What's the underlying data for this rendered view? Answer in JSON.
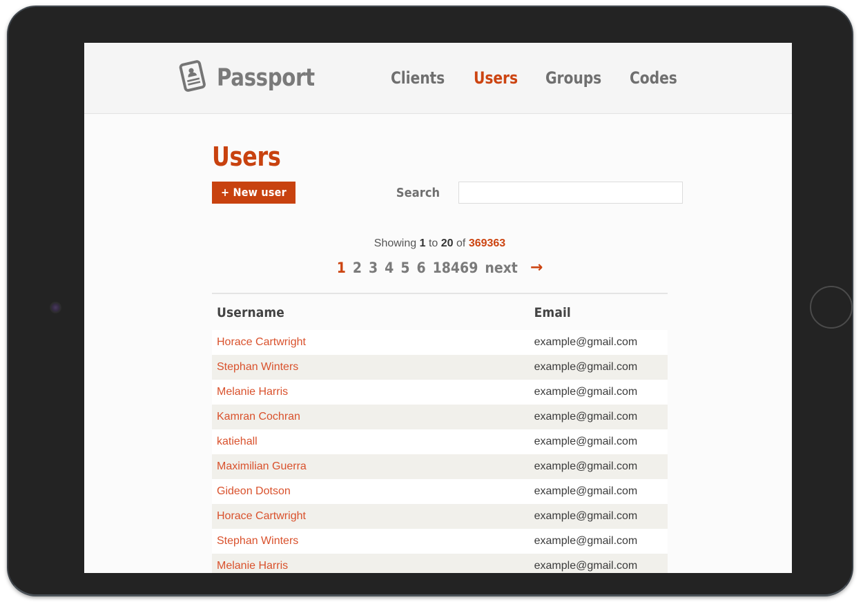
{
  "brand": {
    "name": "Passport",
    "icon": "id-card-icon"
  },
  "nav": {
    "items": [
      {
        "label": "Clients",
        "active": false
      },
      {
        "label": "Users",
        "active": true
      },
      {
        "label": "Groups",
        "active": false
      },
      {
        "label": "Codes",
        "active": false
      }
    ]
  },
  "page": {
    "title": "Users"
  },
  "actions": {
    "new_user_label": "+ New user",
    "search_label": "Search",
    "search_value": "",
    "search_placeholder": ""
  },
  "pagination": {
    "showing_prefix": "Showing",
    "from": "1",
    "to_word": "to",
    "to": "20",
    "of_word": "of",
    "total": "369363",
    "pages": [
      "1",
      "2",
      "3",
      "4",
      "5",
      "6",
      "18469"
    ],
    "current_page": "1",
    "next_label": "next",
    "next_arrow": "→"
  },
  "table": {
    "columns": [
      "Username",
      "Email"
    ],
    "rows": [
      {
        "username": "Horace Cartwright",
        "email": "example@gmail.com"
      },
      {
        "username": "Stephan Winters",
        "email": "example@gmail.com"
      },
      {
        "username": "Melanie Harris",
        "email": "example@gmail.com"
      },
      {
        "username": "Kamran Cochran",
        "email": "example@gmail.com"
      },
      {
        "username": "katiehall",
        "email": "example@gmail.com"
      },
      {
        "username": "Maximilian Guerra",
        "email": "example@gmail.com"
      },
      {
        "username": "Gideon Dotson",
        "email": "example@gmail.com"
      },
      {
        "username": "Horace Cartwright",
        "email": "example@gmail.com"
      },
      {
        "username": "Stephan Winters",
        "email": "example@gmail.com"
      },
      {
        "username": "Melanie Harris",
        "email": "example@gmail.com"
      }
    ]
  },
  "device": {
    "camera_icon": "camera-lens-icon",
    "home_button_icon": "home-button-icon"
  },
  "colors": {
    "accent": "#cc4411",
    "title": "#c8420f",
    "link": "#d9512c",
    "nav_inactive": "#6f6f6f",
    "row_alt": "#f1f0eb",
    "bezel": "#232323"
  }
}
